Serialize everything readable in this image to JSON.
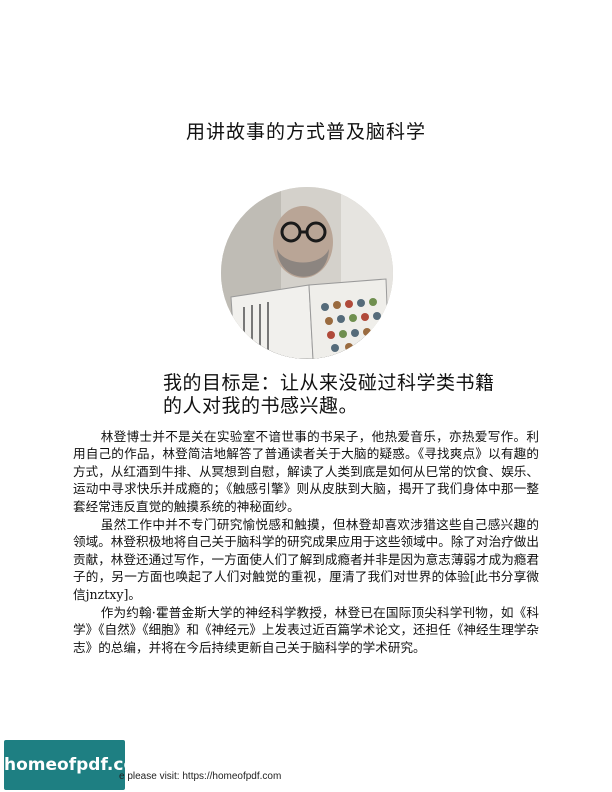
{
  "title": "用讲故事的方式普及脑科学",
  "tagline": {
    "line1": "我的目标是：让从来没碰过科学类书籍",
    "line2": "的人对我的书感兴趣。"
  },
  "paragraphs": [
    "林登博士并不是关在实验室不谙世事的书呆子，他热爱音乐，亦热爱写作。利用自己的作品，林登简洁地解答了普通读者关于大脑的疑惑。《寻找爽点》以有趣的方式，从红酒到牛排、从冥想到自慰，解读了人类到底是如何从巳常的饮食、娱乐、运动中寻求快乐并成瘾的；《触感引擎》则从皮肤到大脑，揭开了我们身体中那一整套经常违反直觉的触摸系统的神秘面纱。",
    "虽然工作中并不专门研究愉悦感和触摸，但林登却喜欢涉猎这些自己感兴趣的领域。林登积极地将自己关于脑科学的研究成果应用于这些领域中。除了对治疗做出贡献，林登还通过写作，一方面使人们了解到成瘾者并非是因为意志薄弱才成为瘾君子的，另一方面也唤起了人们对触觉的重视，厘清了我们对世界的体验[此书分享微 信jnztxy]。",
    "作为约翰·霍普金斯大学的神经科学教授，林登已在国际顶尖科学刊物，如《科学》《自然》《细胞》和《神经元》上发表过近百篇学术论文，还担任《神经生理学杂志》的总编，并将在今后持续更新自己关于脑科学的学术研究。"
  ],
  "badge": "homeofpdf.com",
  "footer": "e please visit: https://homeofpdf.com",
  "colors": {
    "badge": "#1e7f82",
    "text": "#111111"
  }
}
